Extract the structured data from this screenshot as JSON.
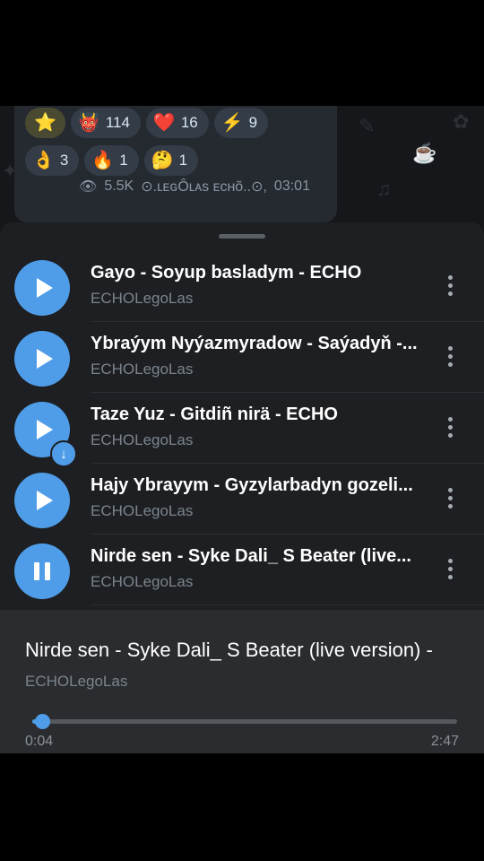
{
  "message": {
    "reactions_row1": [
      {
        "emoji": "⭐",
        "count": "",
        "icon": "star-icon"
      },
      {
        "emoji": "👹",
        "count": "114",
        "icon": "devil-icon"
      },
      {
        "emoji": "❤️",
        "count": "16",
        "icon": "heart-icon"
      },
      {
        "emoji": "⚡",
        "count": "9",
        "icon": "lightning-icon"
      }
    ],
    "reactions_row2": [
      {
        "emoji": "👌",
        "count": "3",
        "icon": "ok-hand-icon"
      },
      {
        "emoji": "🔥",
        "count": "1",
        "icon": "fire-icon"
      },
      {
        "emoji": "🤔",
        "count": "1",
        "icon": "thinking-icon"
      }
    ],
    "views": "5.5K",
    "author": "⊙.ʟᴇɢÔʟᴀs ᴇᴄʜõ..⊙,",
    "time": "03:01"
  },
  "tracks": [
    {
      "title": "Gayo - Soyup basladym - ECHO",
      "artist": "ECHOLegoLas",
      "state": "play",
      "downloading": false
    },
    {
      "title": "Ybraýym Nyýazmyradow - Saýadyň -...",
      "artist": "ECHOLegoLas",
      "state": "play",
      "downloading": false
    },
    {
      "title": "Taze Yuz - Gitdiñ nirä - ECHO",
      "artist": "ECHOLegoLas",
      "state": "play",
      "downloading": true
    },
    {
      "title": "Hajy Ybrayym - Gyzylarbadyn gozeli...",
      "artist": "ECHOLegoLas",
      "state": "play",
      "downloading": false
    },
    {
      "title": "Nirde sen - Syke Dali_ S Beater (live...",
      "artist": "ECHOLegoLas",
      "state": "pause",
      "downloading": false
    }
  ],
  "player": {
    "title": "Nirde sen - Syke Dali_ S Beater (live version) -",
    "artist": "ECHOLegoLas",
    "current_time": "0:04",
    "total_time": "2:47",
    "progress": 0.024
  },
  "colors": {
    "accent": "#4f9de8",
    "sheet": "#1d1f22",
    "player": "#2a2c2f"
  }
}
